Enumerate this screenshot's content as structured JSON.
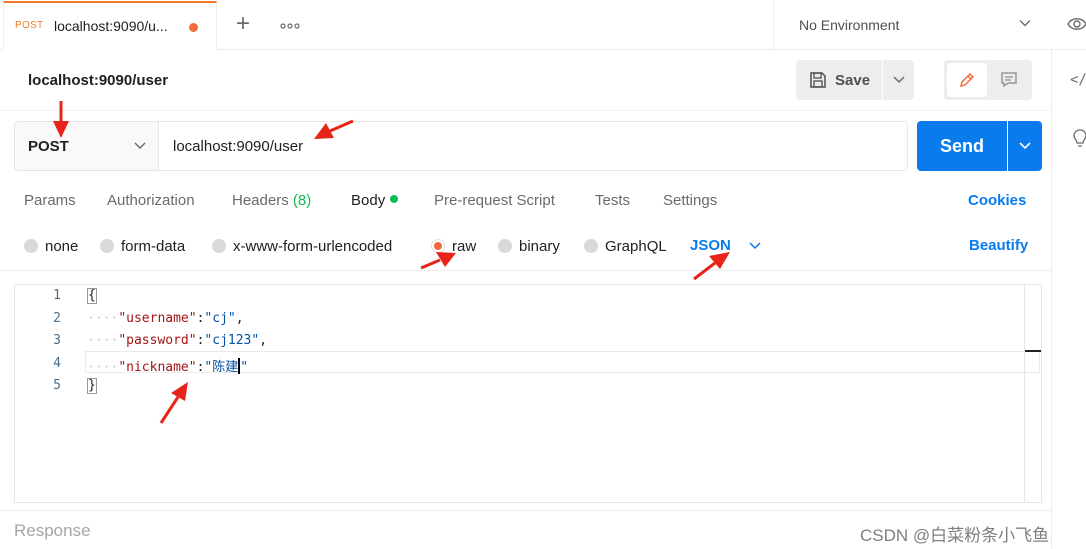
{
  "tab": {
    "method": "POST",
    "title": "localhost:9090/u..."
  },
  "tabbar": {
    "plus": "+",
    "more": "ooo"
  },
  "environment": {
    "label": "No Environment"
  },
  "request": {
    "title": "localhost:9090/user",
    "method": "POST",
    "url": "localhost:9090/user"
  },
  "toolbar": {
    "save_label": "Save",
    "send_label": "Send"
  },
  "request_tabs": {
    "params": "Params",
    "authorization": "Authorization",
    "headers": "Headers",
    "headers_count": "(8)",
    "body": "Body",
    "prerequest": "Pre-request Script",
    "tests": "Tests",
    "settings": "Settings",
    "cookies": "Cookies"
  },
  "body_types": {
    "none": "none",
    "form_data": "form-data",
    "urlencoded": "x-www-form-urlencoded",
    "raw": "raw",
    "binary": "binary",
    "graphql": "GraphQL",
    "selected": "raw",
    "format": "JSON",
    "beautify": "Beautify"
  },
  "editor": {
    "line_numbers": [
      "1",
      "2",
      "3",
      "4",
      "5"
    ],
    "lines": [
      {
        "open": "{"
      },
      {
        "indent": "····",
        "key": "\"username\"",
        "sep": ":",
        "value": "\"cj\"",
        "end": ","
      },
      {
        "indent": "····",
        "key": "\"password\"",
        "sep": ":",
        "value": "\"cj123\"",
        "end": ","
      },
      {
        "indent": "····",
        "key": "\"nickname\"",
        "sep": ":",
        "value": "\"陈建",
        "end": "\""
      },
      {
        "close": "}"
      }
    ]
  },
  "response": {
    "label": "Response"
  },
  "watermark": "CSDN @白菜粉条小飞鱼",
  "colors": {
    "accent": "#097bed",
    "post": "#f27b2d",
    "modified_dot": "#f26b3a",
    "body_dot": "#0cbb52",
    "annotation_arrow": "#e8241a"
  }
}
